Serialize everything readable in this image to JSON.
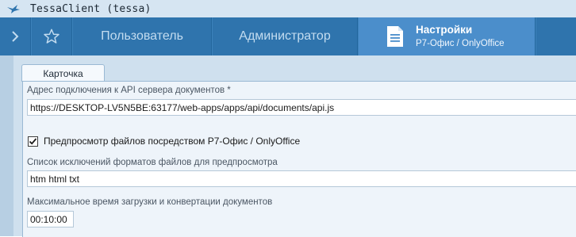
{
  "window": {
    "title": "TessaClient (tessa)",
    "app_icon": "tessa-bird-icon"
  },
  "tabbar": {
    "back_icon": "chevron-right-icon",
    "favorites_icon": "star-icon",
    "tabs": [
      {
        "label": "Пользователь"
      },
      {
        "label": "Администратор"
      }
    ],
    "active_tab": {
      "icon": "document-icon",
      "title": "Настройки",
      "subtitle": "Р7-Офис / OnlyOffice"
    }
  },
  "card": {
    "tab_label": "Карточка",
    "server_url": {
      "label": "Адрес подключения к API сервера документов  *",
      "value": "https://DESKTOP-LV5N5BE:63177/web-apps/apps/api/documents/api.js"
    },
    "preview_checkbox": {
      "checked": true,
      "label": "Предпросмотр файлов посредством Р7-Офис / OnlyOffice"
    },
    "exclusions": {
      "label": "Список исключений форматов файлов для предпросмотра",
      "value": "htm html txt"
    },
    "timeout": {
      "label": "Максимальное время загрузки и конвертации документов",
      "value": "00:10:00"
    }
  },
  "colors": {
    "tabbar": "#2f74ad",
    "active_tab": "#4b8ecb",
    "content_bg": "#cfe0ee"
  }
}
